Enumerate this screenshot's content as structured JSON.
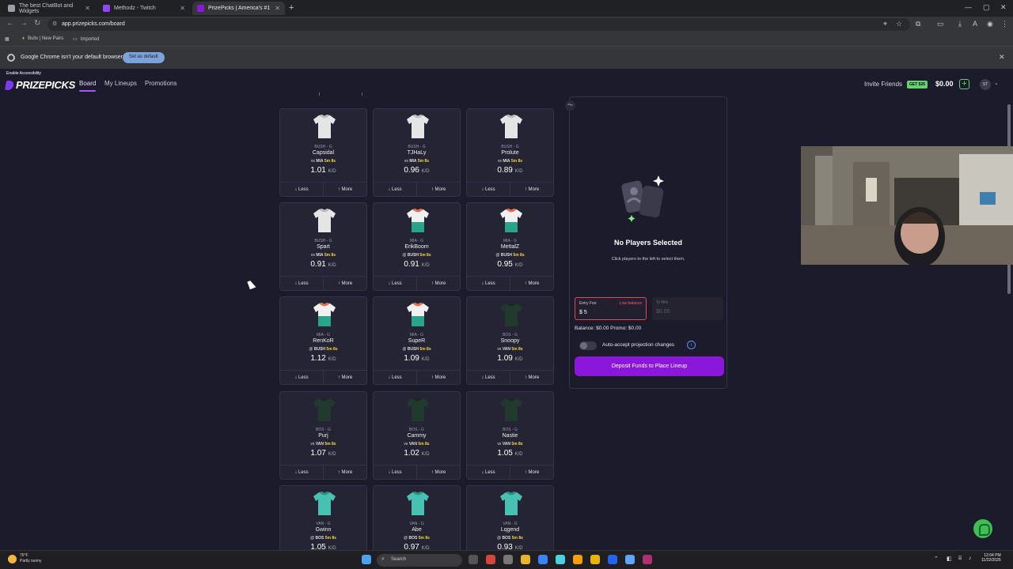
{
  "browser": {
    "tabs": [
      {
        "title": "The best ChatBot and Widgets",
        "active": false
      },
      {
        "title": "Methodz - Twitch",
        "active": false
      },
      {
        "title": "PrizePicks | America's #1 Fantas",
        "active": true
      }
    ],
    "url": "app.prizepicks.com/board",
    "bookmarks": [
      "Bullx | New Pairs",
      "Imported"
    ],
    "infobar": {
      "message": "Google Chrome isn't your default browser",
      "button": "Set as default"
    }
  },
  "app": {
    "accessibility_link": "Enable Accessibility",
    "logo": "PRIZEPICKS",
    "nav": [
      "Board",
      "My Lineups",
      "Promotions"
    ],
    "invite": "Invite Friends",
    "invite_badge": "GET $25",
    "balance": "$0.00",
    "avatar": "ST",
    "more_label": "More",
    "less_label": "Less",
    "stat_unit": "K/D",
    "players": [
      {
        "team": "BUSH - G",
        "name": "Capsidal",
        "opp_prefix": "vs",
        "opp": "MIA",
        "time": "5m 8s",
        "line": "1.01",
        "jersey": "white"
      },
      {
        "team": "BUSH - G",
        "name": "TJHaLy",
        "opp_prefix": "vs",
        "opp": "MIA",
        "time": "5m 8s",
        "line": "0.96",
        "jersey": "white"
      },
      {
        "team": "BUSH - G",
        "name": "Prolute",
        "opp_prefix": "vs",
        "opp": "MIA",
        "time": "5m 8s",
        "line": "0.89",
        "jersey": "white"
      },
      {
        "team": "BUSH - G",
        "name": "Spart",
        "opp_prefix": "vs",
        "opp": "MIA",
        "time": "5m 8s",
        "line": "0.91",
        "jersey": "white"
      },
      {
        "team": "MIA - G",
        "name": "ErikBoom",
        "opp_prefix": "@",
        "opp": "BUSH",
        "time": "5m 8s",
        "line": "0.91",
        "jersey": "mia"
      },
      {
        "team": "MIA - G",
        "name": "MettalZ",
        "opp_prefix": "@",
        "opp": "BUSH",
        "time": "5m 8s",
        "line": "0.95",
        "jersey": "mia"
      },
      {
        "team": "MIA - G",
        "name": "RenKoR",
        "opp_prefix": "@",
        "opp": "BUSH",
        "time": "5m 8s",
        "line": "1.12",
        "jersey": "mia"
      },
      {
        "team": "MIA - G",
        "name": "SupeR",
        "opp_prefix": "@",
        "opp": "BUSH",
        "time": "5m 8s",
        "line": "1.09",
        "jersey": "mia"
      },
      {
        "team": "BOS - G",
        "name": "Snoopy",
        "opp_prefix": "vs",
        "opp": "VAN",
        "time": "5m 8s",
        "line": "1.09",
        "jersey": "bos"
      },
      {
        "team": "BOS - G",
        "name": "Purj",
        "opp_prefix": "vs",
        "opp": "VAN",
        "time": "5m 8s",
        "line": "1.07",
        "jersey": "bos"
      },
      {
        "team": "BOS - G",
        "name": "Cammy",
        "opp_prefix": "vs",
        "opp": "VAN",
        "time": "5m 8s",
        "line": "1.02",
        "jersey": "bos"
      },
      {
        "team": "BOS - G",
        "name": "Nastie",
        "opp_prefix": "vs",
        "opp": "VAN",
        "time": "5m 8s",
        "line": "1.05",
        "jersey": "bos"
      },
      {
        "team": "VAN - G",
        "name": "Gwinn",
        "opp_prefix": "@",
        "opp": "BOS",
        "time": "5m 8s",
        "line": "1.05",
        "jersey": "van"
      },
      {
        "team": "VAN - G",
        "name": "Abe",
        "opp_prefix": "@",
        "opp": "BOS",
        "time": "5m 8s",
        "line": "0.97",
        "jersey": "van"
      },
      {
        "team": "VAN - G",
        "name": "Lqgend",
        "opp_prefix": "@",
        "opp": "BOS",
        "time": "5m 8s",
        "line": "0.93",
        "jersey": "van"
      }
    ],
    "lineup": {
      "title": "No Players Selected",
      "hint": "Click players to the left to select them.",
      "entry_fee_label": "Entry Fee",
      "entry_fee_warning": "Low balance",
      "entry_fee_value": "$ 5",
      "to_win_label": "To Win",
      "to_win_value": "$0.00",
      "balance_line": "Balance: $0.00   Promo: $0.00",
      "auto_accept": "Auto-accept projection changes",
      "deposit_button": "Deposit Funds to Place Lineup"
    }
  },
  "taskbar": {
    "temp": "76°F",
    "weather": "Partly sunny",
    "search": "Search",
    "time": "12:04 PM",
    "date": "11/22/2025"
  },
  "colors": {
    "accent": "#8a17d9",
    "green": "#65d36e",
    "warning": "#ff5a6c",
    "highlight": "#f5d742"
  }
}
